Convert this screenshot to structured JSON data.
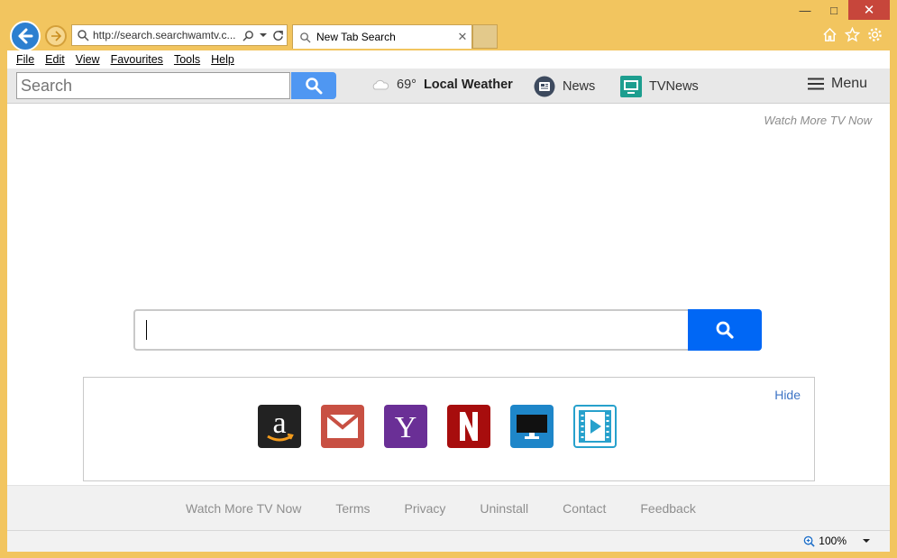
{
  "browser": {
    "address": "http://search.searchwamtv.c...",
    "tab_title": "New Tab Search",
    "menu": [
      "File",
      "Edit",
      "View",
      "Favourites",
      "Tools",
      "Help"
    ]
  },
  "toolbar": {
    "search_placeholder": "Search",
    "weather_temp": "69°",
    "weather_label": "Local Weather",
    "news_label": "News",
    "tvnews_label": "TVNews",
    "menu_label": "Menu"
  },
  "page": {
    "watch_top": "Watch More TV Now",
    "hide_label": "Hide",
    "tiles": [
      {
        "icon": "amazon-icon",
        "color": "#222222"
      },
      {
        "icon": "gmail-icon",
        "color": "#c85043"
      },
      {
        "icon": "yahoo-icon",
        "color": "#6a2f96"
      },
      {
        "icon": "netflix-icon",
        "color": "#a70d0d"
      },
      {
        "icon": "monitor-icon",
        "color": "#1e86c9"
      },
      {
        "icon": "video-icon",
        "color": "#27a1cc"
      }
    ]
  },
  "footer": {
    "links": [
      "Watch More TV Now",
      "Terms",
      "Privacy",
      "Uninstall",
      "Contact",
      "Feedback"
    ]
  },
  "status": {
    "zoom": "100%"
  },
  "colors": {
    "frame": "#f2c55f",
    "accent_blue": "#0067f5",
    "toolbar_btn": "#4f97f2"
  }
}
